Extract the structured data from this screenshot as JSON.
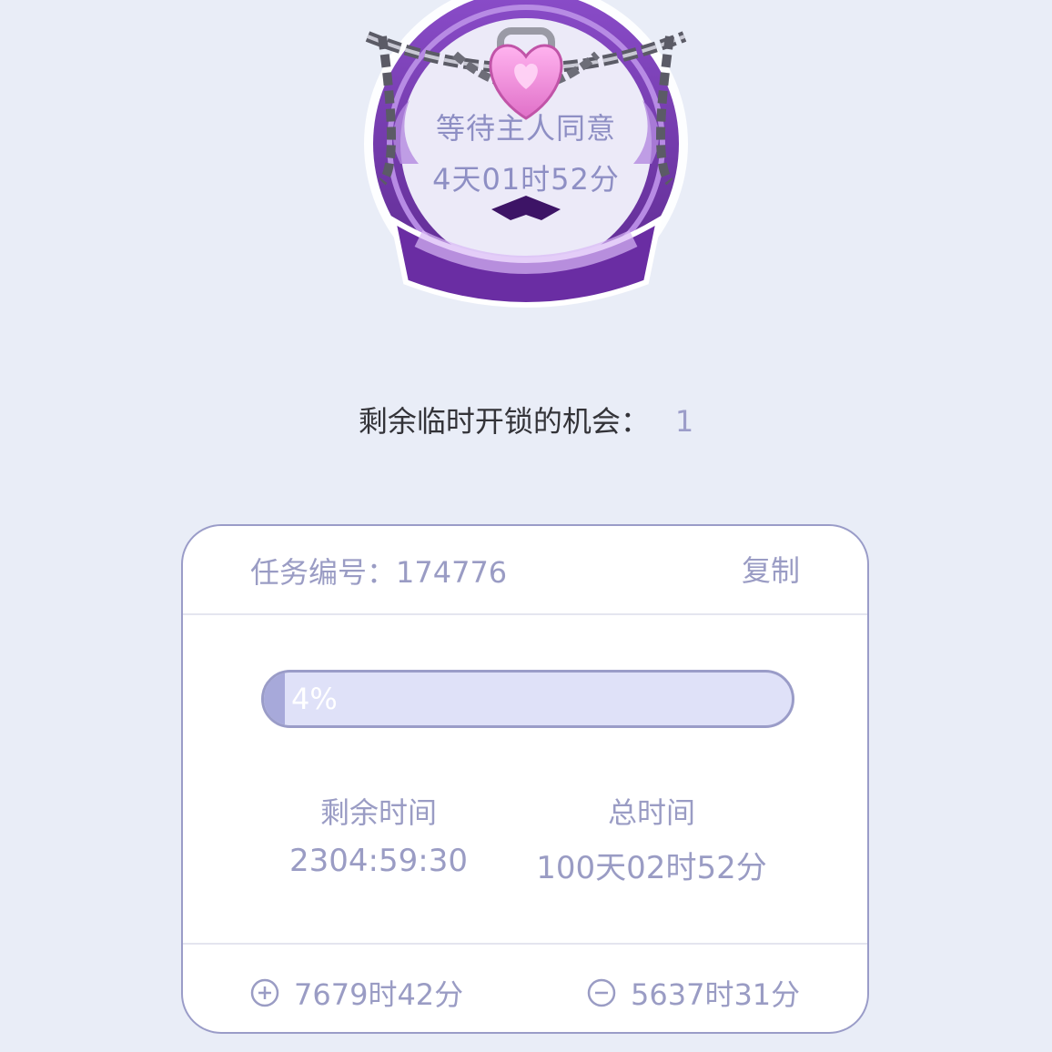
{
  "badge": {
    "status_text": "等待主人同意",
    "countdown": "4天01时52分"
  },
  "chances": {
    "label": "剩余临时开锁的机会：",
    "count": "1"
  },
  "task": {
    "label": "任务编号：174776",
    "copy_label": "复制"
  },
  "progress": {
    "percent": 4,
    "label": "4%"
  },
  "stats": {
    "remaining_label": "剩余时间",
    "remaining_value": "2304:59:30",
    "total_label": "总时间",
    "total_value": "100天02时52分"
  },
  "adjust": {
    "add_value": "7679时42分",
    "add_icon": "plus-circle-icon",
    "sub_value": "5637时31分",
    "sub_icon": "minus-circle-icon"
  },
  "colors": {
    "background": "#e9edf7",
    "accent": "#9a9cc8",
    "progress_track": "#dfe1f8",
    "badge_purple": "#7a3fb5",
    "heart_pink": "#f08ad8"
  }
}
